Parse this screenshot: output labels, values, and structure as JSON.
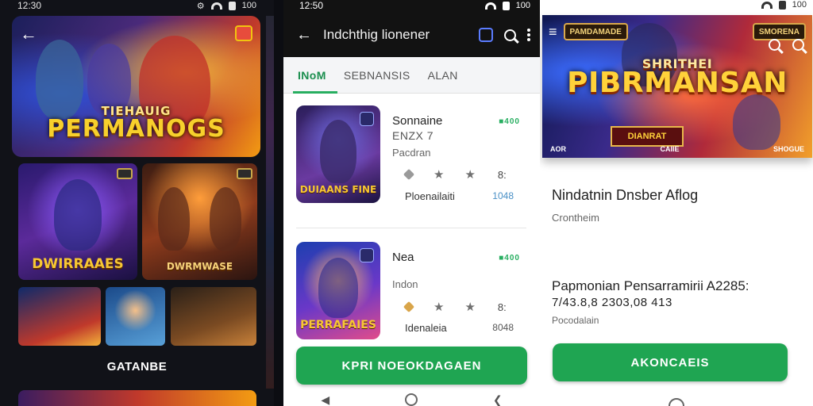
{
  "panel1": {
    "status": {
      "time": "12:30",
      "battery": "100"
    },
    "hero_title_small": "TIEHAUIG",
    "hero_title": "PERMANOGS",
    "tile_a_title": "DWIRRAAES",
    "tile_b_title": "DWRMWASE",
    "section_label": "GATANBE"
  },
  "panel2": {
    "status": {
      "time": "12:50",
      "battery": "100"
    },
    "title": "Indchthig lionener",
    "tabs": [
      {
        "label": "INoM",
        "active": true
      },
      {
        "label": "SEBNANSIS",
        "active": false
      },
      {
        "label": "ALAN",
        "active": false
      }
    ],
    "cards": [
      {
        "name": "Sonnaine",
        "sub": "ENZX 7",
        "meta": "Pacdran",
        "price": "■400",
        "rating_count": "8:",
        "publisher": "Ploenailaiti",
        "reviews": "1048",
        "thumb_title": "DUIAANS FINE"
      },
      {
        "name": "Nea",
        "sub": "",
        "meta": "Indon",
        "price": "■400",
        "rating_count": "8:",
        "publisher": "Idenaleia",
        "reviews": "8048",
        "thumb_title": "PERRAFAIES"
      }
    ],
    "button": "KPRI NOEOKDAGAEN"
  },
  "panel3": {
    "status": {
      "battery": "100"
    },
    "banner_title_small": "SHRITHEI",
    "banner_title": "PIBRMANSAN",
    "banner_badge": "DIANRAT",
    "banner_pills": [
      "PAMDAMADE",
      "SMORENA"
    ],
    "banner_foot": [
      "AOR",
      "CAIIE",
      "SHOGUE"
    ],
    "title": "Nindatnin Dnsber Aflog",
    "developer": "Crontheim",
    "section_heading": "Papmonian Pensarramirii A2285:",
    "identifier": "7/43.8,8 2303,08 413",
    "meta": "Pocodalain",
    "button": "AKONCAEIS"
  }
}
